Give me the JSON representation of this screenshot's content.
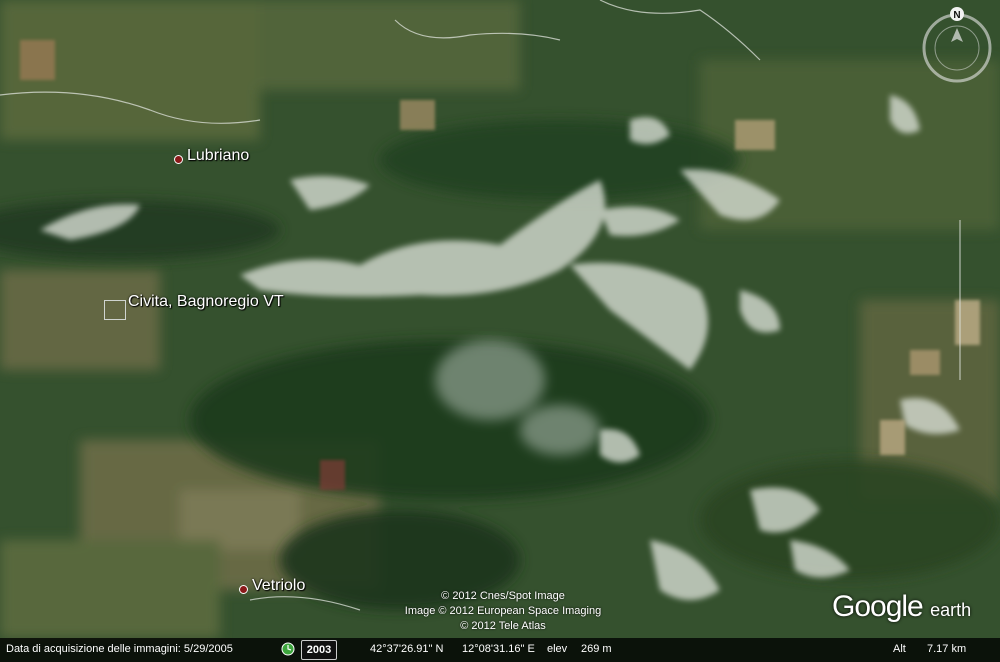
{
  "places": {
    "lubriano": "Lubriano",
    "civita": "Civita, Bagnoregio VT",
    "vetriolo": "Vetriolo"
  },
  "copyright": {
    "line1": "© 2012 Cnes/Spot Image",
    "line2": "Image © 2012 European Space Imaging",
    "line3": "© 2012 Tele Atlas"
  },
  "logo": {
    "google": "Google",
    "earth": "earth"
  },
  "compass": {
    "north_label": "N"
  },
  "status": {
    "acquisition": "Data di acquisizione delle immagini: 5/29/2005",
    "year": "2003",
    "lat": "42°37'26.91\" N",
    "lon": "12°08'31.16\" E",
    "elev_label": "elev",
    "elev_value": "269 m",
    "alt_label": "Alt",
    "alt_value": "7.17 km"
  },
  "colors": {
    "forest": "#2f4a2a",
    "ridge": "#d9dfd6",
    "field": "#8a8a5c",
    "marker": "#8b1a1a"
  },
  "icons": [
    "clock-icon",
    "compass-icon",
    "look-ring-icon",
    "north-arrow-icon"
  ]
}
